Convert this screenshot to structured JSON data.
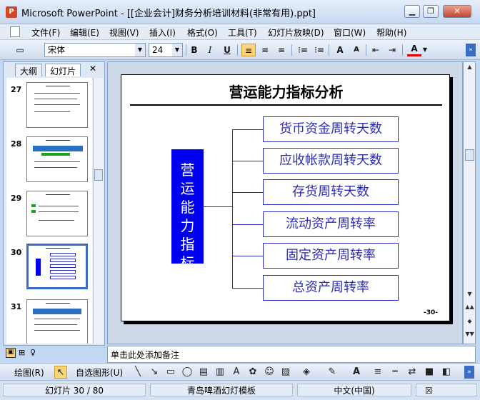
{
  "window": {
    "app_icon": "P",
    "title": "Microsoft PowerPoint - [[企业会计]财务分析培训材料(非常有用).ppt]",
    "minimize": "▁",
    "restore": "❐",
    "close": "✕"
  },
  "menu": {
    "items": [
      "文件(F)",
      "编辑(E)",
      "视图(V)",
      "插入(I)",
      "格式(O)",
      "工具(T)",
      "幻灯片放映(D)",
      "窗口(W)",
      "帮助(H)"
    ]
  },
  "format_toolbar": {
    "font_name": "宋体",
    "font_size": "24",
    "bold": "B",
    "italic": "I",
    "underline": "U",
    "align_left": "≡",
    "align_center": "≡",
    "align_right": "≡",
    "font_color": "A",
    "grow_font": "A",
    "shrink_font": "A"
  },
  "left_pane": {
    "tab_outline": "大纲",
    "tab_slides": "幻灯片",
    "close": "✕",
    "thumbnails": [
      {
        "num": "27",
        "selected": false
      },
      {
        "num": "28",
        "selected": false
      },
      {
        "num": "29",
        "selected": false
      },
      {
        "num": "30",
        "selected": true
      },
      {
        "num": "31",
        "selected": false
      }
    ]
  },
  "slide": {
    "title": "营运能力指标分析",
    "root": "营运能力指标",
    "branches": [
      "货币资金周转天数",
      "应收帐款周转天数",
      "存货周转天数",
      "流动资产周转率",
      "固定资产周转率",
      "总资产周转率"
    ],
    "page_number": "-30-",
    "root_color": "#0000f0",
    "branch_text_color": "#2d2db0"
  },
  "notes": {
    "placeholder": "单击此处添加备注"
  },
  "draw_toolbar": {
    "draw_label": "绘图(R)",
    "autoshapes_label": "自选图形(U)"
  },
  "status": {
    "slide_info": "幻灯片 30 / 80",
    "template": "青岛啤酒幻灯模板",
    "language": "中文(中国)"
  }
}
